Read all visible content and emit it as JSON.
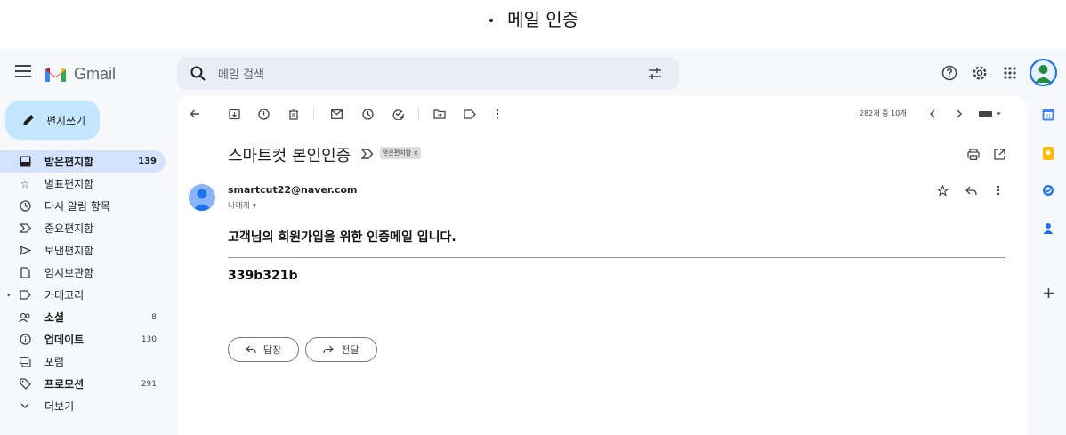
{
  "caption": {
    "bullet": "•",
    "text": "메일 인증"
  },
  "topbar": {
    "logo_text": "Gmail",
    "search_placeholder": "메일 검색"
  },
  "sidebar": {
    "compose_label": "편지쓰기",
    "items": [
      {
        "label": "받은편지함",
        "count": "139",
        "icon": "inbox-icon"
      },
      {
        "label": "별표편지함",
        "count": "",
        "icon": "star-icon"
      },
      {
        "label": "다시 알림 항목",
        "count": "",
        "icon": "clock-icon"
      },
      {
        "label": "중요편지함",
        "count": "",
        "icon": "important-icon"
      },
      {
        "label": "보낸편지함",
        "count": "",
        "icon": "send-icon"
      },
      {
        "label": "임시보관함",
        "count": "",
        "icon": "draft-icon"
      },
      {
        "label": "카테고리",
        "count": "",
        "icon": "label-icon"
      },
      {
        "label": "소셜",
        "count": "8",
        "icon": "people-icon"
      },
      {
        "label": "업데이트",
        "count": "130",
        "icon": "info-icon"
      },
      {
        "label": "포럼",
        "count": "",
        "icon": "forum-icon"
      },
      {
        "label": "프로모션",
        "count": "291",
        "icon": "tag-icon"
      },
      {
        "label": "더보기",
        "count": "",
        "icon": "chevron-down-icon"
      }
    ]
  },
  "toolbar": {
    "pager": "282개 중 10개"
  },
  "message": {
    "subject": "스마트컷 본인인증",
    "label_chip": "받은편지함 ×",
    "sender": "smartcut22@naver.com",
    "to": "나에게 ▾",
    "heading": "고객님의 회원가입을 위한 인증메일 입니다.",
    "code": "339b321b",
    "reply_label": "답장",
    "forward_label": "전달"
  },
  "colors": {
    "compose_bg": "#c2e7ff",
    "active_nav": "#d3e3fd",
    "app_bg": "#f6f8fc",
    "search_bg": "#e9eef6"
  }
}
